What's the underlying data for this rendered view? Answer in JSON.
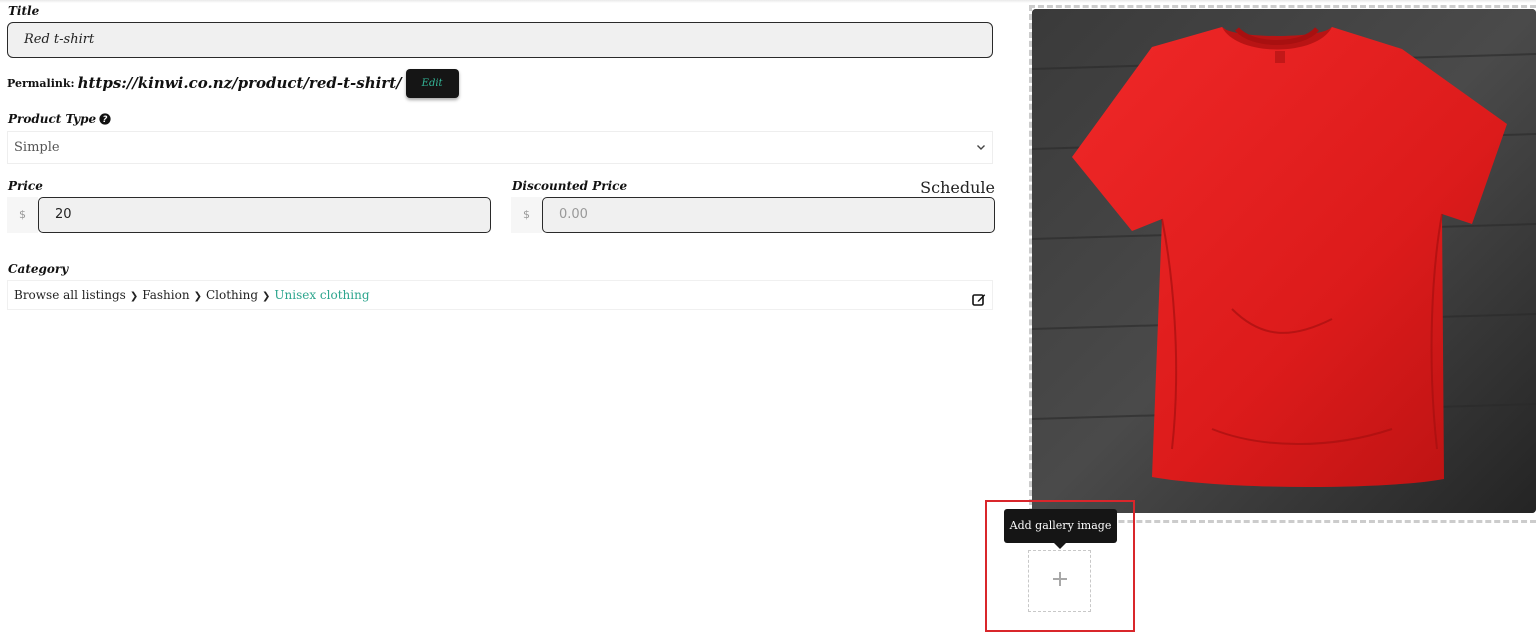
{
  "form": {
    "title_label": "Title",
    "title_value": "Red t-shirt",
    "permalink_label": "Permalink:",
    "permalink_url": "https://kinwi.co.nz/product/red-t-shirt/",
    "permalink_edit_label": "Edit",
    "product_type_label": "Product Type",
    "product_type_help_icon": "question-circle-icon",
    "product_type_value": "Simple",
    "price_label": "Price",
    "price_currency": "$",
    "price_value": "20",
    "discounted_price_label": "Discounted Price",
    "discounted_currency": "$",
    "discounted_placeholder": "0.00",
    "schedule_label": "Schedule",
    "category_label": "Category",
    "category_path": [
      "Browse all listings",
      "Fashion",
      "Clothing"
    ],
    "category_current": "Unisex clothing",
    "category_edit_icon": "edit-icon"
  },
  "media": {
    "featured_image_alt": "red-tshirt-photo",
    "gallery_tooltip": "Add gallery image",
    "add_gallery_icon": "plus-icon"
  },
  "colors": {
    "accent_teal": "#2ca58d",
    "dark_button": "#151515",
    "highlight_red": "#d9262b",
    "shirt_red": "#e21d1d"
  }
}
